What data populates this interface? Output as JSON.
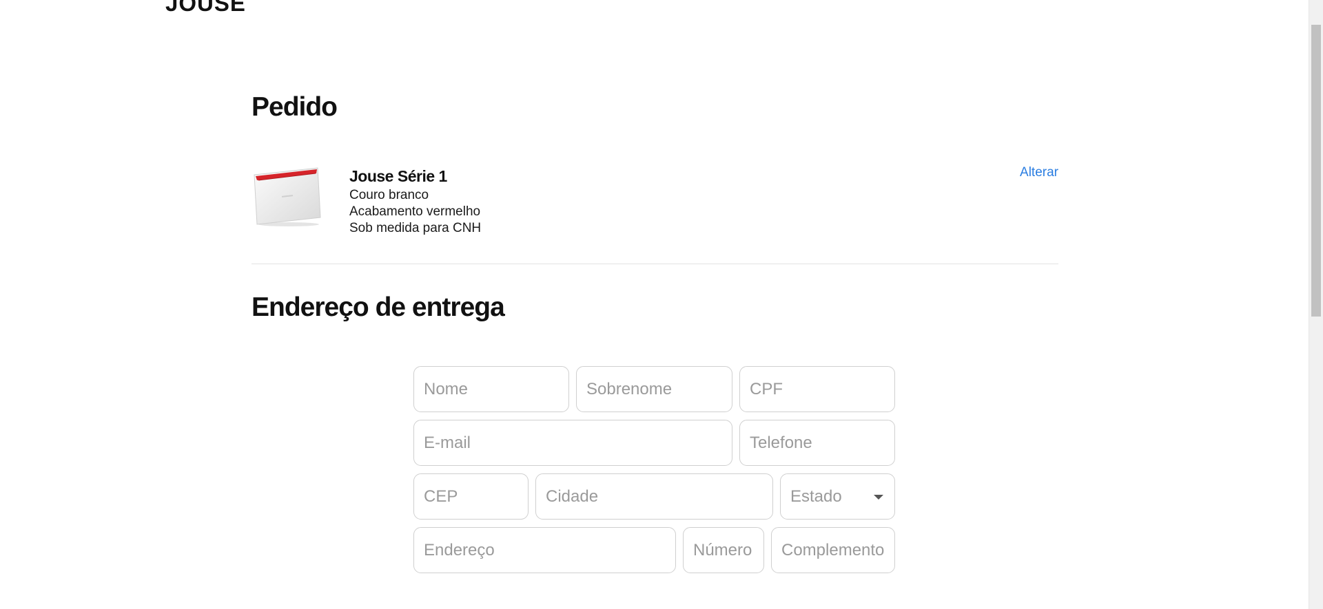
{
  "brand": {
    "logo_text": "JOUSE"
  },
  "order": {
    "title": "Pedido",
    "product": {
      "name": "Jouse Série 1",
      "details": [
        "Couro branco",
        "Acabamento vermelho",
        "Sob medida para CNH"
      ],
      "accent_color": "#d6242a",
      "leather_color": "#f2f2f2"
    },
    "change_label": "Alterar"
  },
  "shipping": {
    "title": "Endereço de entrega",
    "fields": {
      "first_name": "Nome",
      "last_name": "Sobrenome",
      "cpf": "CPF",
      "email": "E-mail",
      "phone": "Telefone",
      "cep": "CEP",
      "city": "Cidade",
      "state": "Estado",
      "address": "Endereço",
      "number": "Número",
      "complement": "Complemento"
    }
  },
  "colors": {
    "link": "#2a7de1",
    "border": "#cfcfcf",
    "placeholder": "#9a9a9a"
  }
}
